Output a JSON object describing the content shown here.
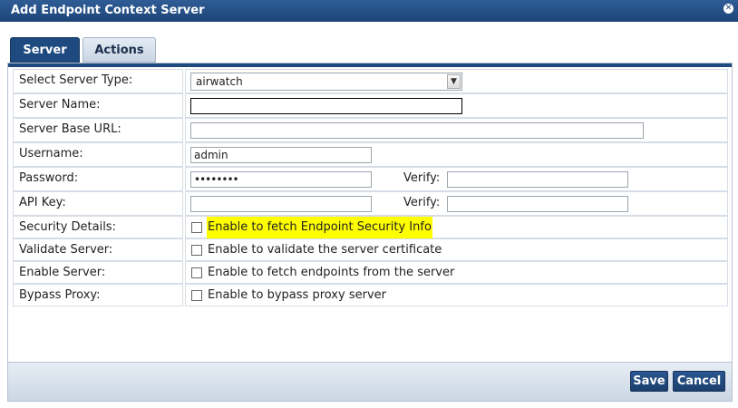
{
  "window": {
    "title": "Add Endpoint Context Server"
  },
  "tabs": [
    {
      "label": "Server"
    },
    {
      "label": "Actions"
    }
  ],
  "form": {
    "server_type": {
      "label": "Select Server Type:",
      "value": "airwatch"
    },
    "server_name": {
      "label": "Server Name:",
      "value": ""
    },
    "base_url": {
      "label": "Server Base URL:",
      "value": ""
    },
    "username": {
      "label": "Username:",
      "value": "admin"
    },
    "password": {
      "label": "Password:",
      "value": "••••••••",
      "verify_label": "Verify:",
      "verify_value": ""
    },
    "api_key": {
      "label": "API Key:",
      "value": "",
      "verify_label": "Verify:",
      "verify_value": ""
    },
    "security_details": {
      "label": "Security Details:",
      "checkbox_label": "Enable to fetch Endpoint Security Info",
      "checked": false
    },
    "validate_server": {
      "label": "Validate Server:",
      "checkbox_label": "Enable to validate the server certificate",
      "checked": false
    },
    "enable_server": {
      "label": "Enable Server:",
      "checkbox_label": "Enable to fetch endpoints from the server",
      "checked": false
    },
    "bypass_proxy": {
      "label": "Bypass Proxy:",
      "checkbox_label": "Enable to bypass proxy server",
      "checked": false
    }
  },
  "buttons": {
    "save": "Save",
    "cancel": "Cancel"
  },
  "colors": {
    "title_bar": "#1d4477",
    "active_tab": "#1f4a80",
    "highlight": "#ffff00"
  },
  "icons": {
    "close": "close-icon",
    "dropdown": "chevron-down-icon"
  }
}
